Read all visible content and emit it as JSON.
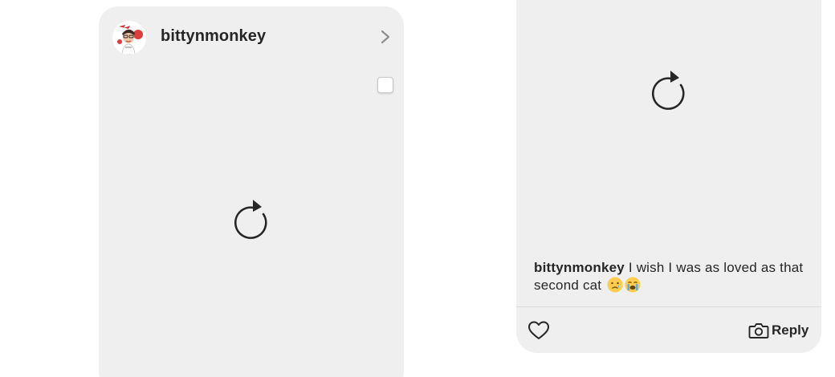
{
  "post": {
    "username": "bittynmonkey",
    "avatar_icon": "bitmoji-avatar",
    "chevron_icon": "chevron-right-icon",
    "media_state_icon": "reload-icon"
  },
  "story_reply": {
    "media_state_icon": "reload-icon",
    "caption_user": "bittynmonkey",
    "caption_text": " I wish I was as loved as that second cat",
    "caption_emojis": [
      "crying-face-emoji",
      "loudly-crying-face-emoji"
    ],
    "like_icon": "heart-icon",
    "reply_icon": "camera-icon",
    "reply_label": "Reply"
  },
  "colors": {
    "card_bg": "#efefef",
    "text": "#262626",
    "icon": "#262626",
    "muted_icon": "#8e8e8e",
    "divider": "#dcdcdc"
  }
}
